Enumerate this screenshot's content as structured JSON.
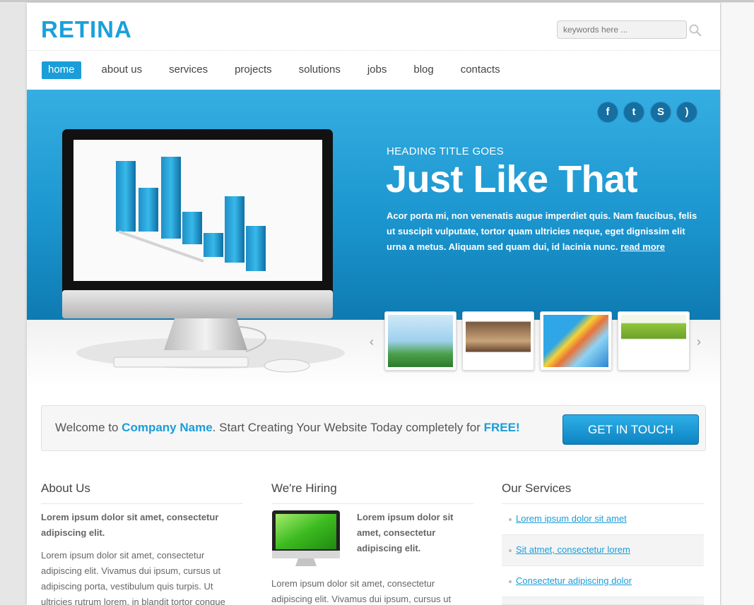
{
  "header": {
    "logo": "RETINA",
    "search_placeholder": "keywords here ..."
  },
  "nav": {
    "items": [
      "home",
      "about us",
      "services",
      "projects",
      "solutions",
      "jobs",
      "blog",
      "contacts"
    ],
    "active": "home"
  },
  "social": [
    "facebook",
    "twitter",
    "skype",
    "rss"
  ],
  "hero": {
    "subtitle": "HEADING TITLE GOES",
    "title": "Just Like That",
    "text": "Acor porta mi, non venenatis augue imperdiet quis. Nam faucibus, felis ut suscipit vulputate, tortor quam ultricies neque, eget dignissim elit urna a metus. Aliquam sed quam dui, id lacinia nunc.",
    "read_more": "read more"
  },
  "welcome": {
    "prefix": "Welcome to ",
    "company": "Company Name",
    "middle": ". Start Creating Your Website Today completely for ",
    "free": "FREE!",
    "cta": "GET IN TOUCH"
  },
  "about": {
    "title": "About Us",
    "lead": "Lorem ipsum dolor sit amet, consectetur adipiscing elit.",
    "body": "Lorem ipsum dolor sit amet, consectetur adipiscing elit. Vivamus dui ipsum, cursus ut adipiscing porta, vestibulum quis turpis. Ut ultricies rutrum lorem, in blandit tortor congue"
  },
  "hiring": {
    "title": "We're Hiring",
    "lead": "Lorem ipsum dolor sit amet, consectetur adipiscing elit.",
    "body": "Lorem ipsum dolor sit amet, consectetur adipiscing elit. Vivamus dui ipsum, cursus ut"
  },
  "services": {
    "title": "Our Services",
    "items": [
      "Lorem ipsum dolor sit amet",
      "Sit atmet, consectetur lorem",
      "Consectetur adipiscing dolor"
    ]
  },
  "colors": {
    "accent": "#1a9dd9",
    "hero_top": "#35aee2",
    "hero_bottom": "#0e7bb2"
  }
}
